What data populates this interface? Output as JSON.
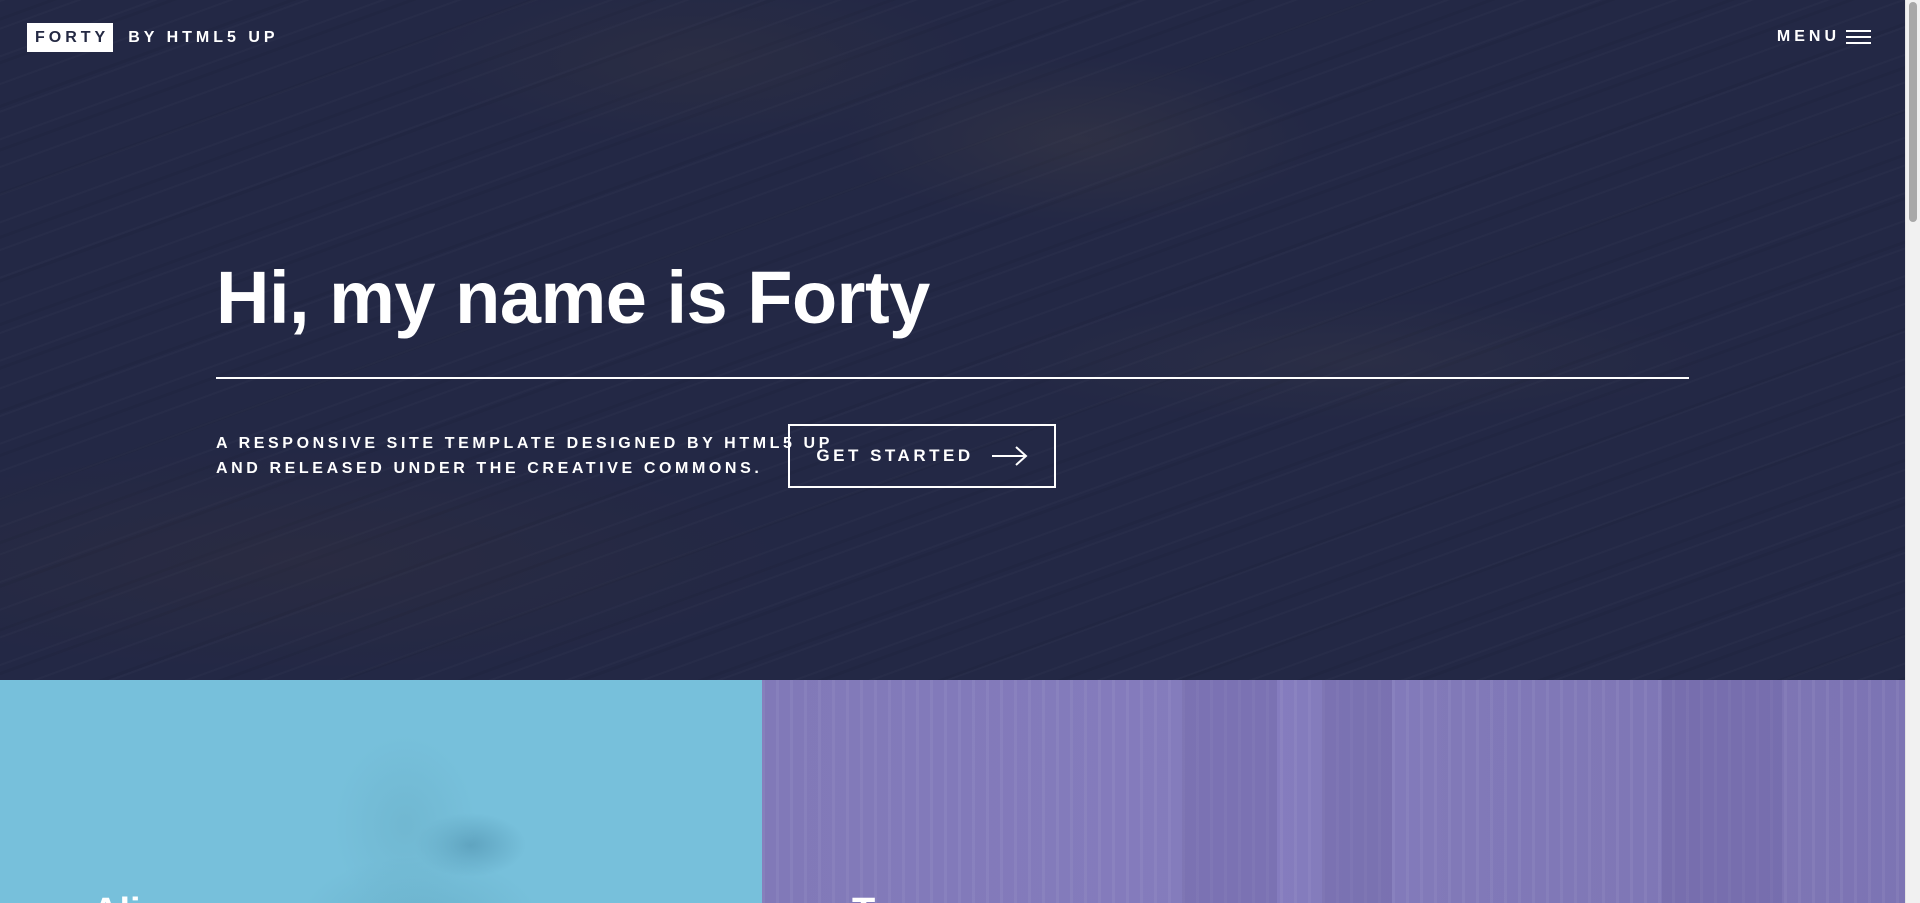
{
  "header": {
    "logo_box": "FORTY",
    "logo_rest": "BY HTML5 UP",
    "menu_label": "MENU"
  },
  "banner": {
    "title": "Hi, my name is Forty",
    "subtitle_line1": "A RESPONSIVE SITE TEMPLATE DESIGNED BY HTML5 UP",
    "subtitle_line2": "AND RELEASED UNDER THE CREATIVE COMMONS.",
    "cta_label": "GET STARTED"
  },
  "tiles": [
    {
      "title": "Ali",
      "color": "#77c0db"
    },
    {
      "title": "T",
      "color": "#8179b8"
    }
  ],
  "colors": {
    "banner_bg": "#232845",
    "accent_white": "#ffffff"
  },
  "icons": {
    "menu": "hamburger-icon",
    "cta": "arrow-right-icon"
  }
}
